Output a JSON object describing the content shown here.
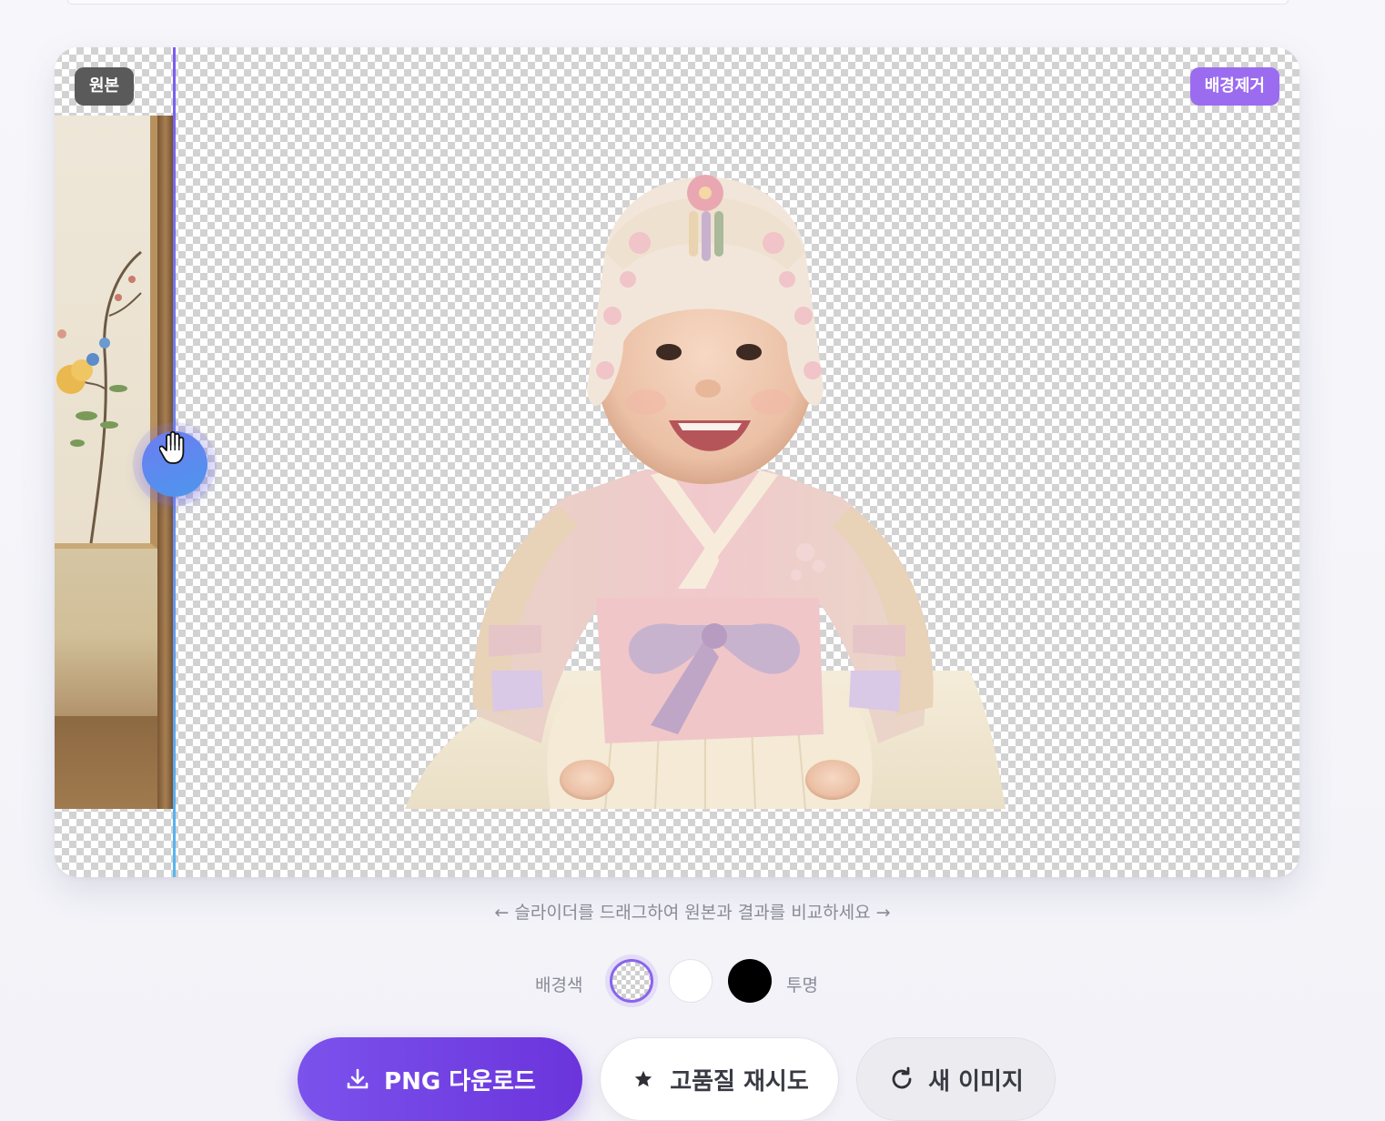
{
  "badges": {
    "original": "원본",
    "removed": "배경제거"
  },
  "comparison": {
    "slider_position": 0.052
  },
  "hint": "← 슬라이더를 드래그하여 원본과 결과를 비교하세요 →",
  "background_picker": {
    "label": "배경색",
    "selected_label": "투명",
    "options": [
      {
        "name": "transparent",
        "color": "checkerboard",
        "selected": true
      },
      {
        "name": "white",
        "color": "#ffffff",
        "selected": false
      },
      {
        "name": "black",
        "color": "#000000",
        "selected": false
      }
    ]
  },
  "actions": {
    "download": {
      "label": "PNG 다운로드",
      "icon": "download-icon"
    },
    "high_quality_retry": {
      "label": "고품질 재시도",
      "icon": "star-icon"
    },
    "new_image": {
      "label": "새 이미지",
      "icon": "refresh-icon"
    }
  },
  "colors": {
    "accent": "#7b52ec",
    "badge_removed": "#9b6cf0",
    "badge_original": "#5a5a5a",
    "slider_handle": "#4c97ec"
  }
}
